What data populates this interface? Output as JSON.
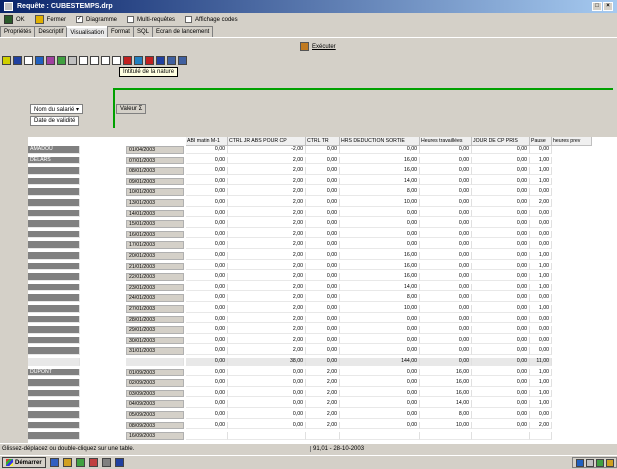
{
  "window": {
    "title": "Requête : CUBESTEMPS.drp"
  },
  "toolbar": {
    "ok_label": "OK",
    "close_label": "Fermer",
    "diagram_label": "Diagramme",
    "multi_label": "Multi-requêtes",
    "codes_label": "Affichage codes",
    "diagram_checked": "✓",
    "multi_checked": "",
    "codes_checked": ""
  },
  "tabs": [
    "Propriétés",
    "Descriptif",
    "Visualisation",
    "Format",
    "SQL",
    "Ecran de lancement"
  ],
  "execute_label": "Exécuter",
  "tooltip": "Intitulé de la nature",
  "fields": {
    "row1": "Nom du salarié",
    "row2": "Date de validité",
    "value": "Valeur"
  },
  "columns": [
    "ABI matin M-1",
    "CTRL JR ABS POUR CP",
    "CTRL TR",
    "HRS DEDUCTION SORTIE",
    "Heures travaillées",
    "JOUR DE CP PRIS",
    "Pause",
    "heures prev"
  ],
  "rows": [
    {
      "name": "AMADOU",
      "date": "01/04/2003",
      "v": [
        "0,00",
        "-2,00",
        "0,00",
        "0,00",
        "0,00",
        "0,00",
        "0,00"
      ],
      "total": false
    },
    {
      "name": "DELARS",
      "date": "07/01/2003",
      "v": [
        "0,00",
        "2,00",
        "0,00",
        "16,00",
        "0,00",
        "0,00",
        "1,00"
      ],
      "total": false
    },
    {
      "name": "",
      "date": "08/01/2003",
      "v": [
        "0,00",
        "2,00",
        "0,00",
        "16,00",
        "0,00",
        "0,00",
        "1,00"
      ],
      "total": false
    },
    {
      "name": "",
      "date": "09/01/2003",
      "v": [
        "0,00",
        "2,00",
        "0,00",
        "14,00",
        "0,00",
        "0,00",
        "1,00"
      ],
      "total": false
    },
    {
      "name": "",
      "date": "10/01/2003",
      "v": [
        "0,00",
        "2,00",
        "0,00",
        "8,00",
        "0,00",
        "0,00",
        "0,00"
      ],
      "total": false
    },
    {
      "name": "",
      "date": "13/01/2003",
      "v": [
        "0,00",
        "2,00",
        "0,00",
        "10,00",
        "0,00",
        "0,00",
        "2,00"
      ],
      "total": false
    },
    {
      "name": "",
      "date": "14/01/2003",
      "v": [
        "0,00",
        "2,00",
        "0,00",
        "0,00",
        "0,00",
        "0,00",
        "0,00"
      ],
      "total": false
    },
    {
      "name": "",
      "date": "15/01/2003",
      "v": [
        "0,00",
        "2,00",
        "0,00",
        "0,00",
        "0,00",
        "0,00",
        "0,00"
      ],
      "total": false
    },
    {
      "name": "",
      "date": "16/01/2003",
      "v": [
        "0,00",
        "2,00",
        "0,00",
        "0,00",
        "0,00",
        "0,00",
        "0,00"
      ],
      "total": false
    },
    {
      "name": "",
      "date": "17/01/2003",
      "v": [
        "0,00",
        "2,00",
        "0,00",
        "0,00",
        "0,00",
        "0,00",
        "0,00"
      ],
      "total": false
    },
    {
      "name": "",
      "date": "20/01/2003",
      "v": [
        "0,00",
        "2,00",
        "0,00",
        "16,00",
        "0,00",
        "0,00",
        "1,00"
      ],
      "total": false
    },
    {
      "name": "",
      "date": "21/01/2003",
      "v": [
        "0,00",
        "2,00",
        "0,00",
        "16,00",
        "0,00",
        "0,00",
        "1,00"
      ],
      "total": false
    },
    {
      "name": "",
      "date": "22/01/2003",
      "v": [
        "0,00",
        "2,00",
        "0,00",
        "16,00",
        "0,00",
        "0,00",
        "1,00"
      ],
      "total": false
    },
    {
      "name": "",
      "date": "23/01/2003",
      "v": [
        "0,00",
        "2,00",
        "0,00",
        "14,00",
        "0,00",
        "0,00",
        "1,00"
      ],
      "total": false
    },
    {
      "name": "",
      "date": "24/01/2003",
      "v": [
        "0,00",
        "2,00",
        "0,00",
        "8,00",
        "0,00",
        "0,00",
        "0,00"
      ],
      "total": false
    },
    {
      "name": "",
      "date": "27/01/2003",
      "v": [
        "0,00",
        "2,00",
        "0,00",
        "10,00",
        "0,00",
        "0,00",
        "1,00"
      ],
      "total": false
    },
    {
      "name": "",
      "date": "28/01/2003",
      "v": [
        "0,00",
        "2,00",
        "0,00",
        "0,00",
        "0,00",
        "0,00",
        "0,00"
      ],
      "total": false
    },
    {
      "name": "",
      "date": "29/01/2003",
      "v": [
        "0,00",
        "2,00",
        "0,00",
        "0,00",
        "0,00",
        "0,00",
        "0,00"
      ],
      "total": false
    },
    {
      "name": "",
      "date": "30/01/2003",
      "v": [
        "0,00",
        "2,00",
        "0,00",
        "0,00",
        "0,00",
        "0,00",
        "0,00"
      ],
      "total": false
    },
    {
      "name": "",
      "date": "31/01/2003",
      "v": [
        "0,00",
        "2,00",
        "0,00",
        "0,00",
        "0,00",
        "0,00",
        "0,00"
      ],
      "total": false
    },
    {
      "name": "",
      "date": "",
      "v": [
        "0,00",
        "38,00",
        "0,00",
        "144,00",
        "0,00",
        "0,00",
        "11,00"
      ],
      "total": true
    },
    {
      "name": "DUPONT",
      "date": "01/09/2003",
      "v": [
        "0,00",
        "0,00",
        "2,00",
        "0,00",
        "16,00",
        "0,00",
        "1,00"
      ],
      "total": false
    },
    {
      "name": "",
      "date": "02/09/2003",
      "v": [
        "0,00",
        "0,00",
        "2,00",
        "0,00",
        "16,00",
        "0,00",
        "1,00"
      ],
      "total": false
    },
    {
      "name": "",
      "date": "03/09/2003",
      "v": [
        "0,00",
        "0,00",
        "2,00",
        "0,00",
        "16,00",
        "0,00",
        "1,00"
      ],
      "total": false
    },
    {
      "name": "",
      "date": "04/09/2003",
      "v": [
        "0,00",
        "0,00",
        "2,00",
        "0,00",
        "14,00",
        "0,00",
        "1,00"
      ],
      "total": false
    },
    {
      "name": "",
      "date": "05/09/2003",
      "v": [
        "0,00",
        "0,00",
        "2,00",
        "0,00",
        "8,00",
        "0,00",
        "0,00"
      ],
      "total": false
    },
    {
      "name": "",
      "date": "08/09/2003",
      "v": [
        "0,00",
        "0,00",
        "2,00",
        "0,00",
        "10,00",
        "0,00",
        "2,00"
      ],
      "total": false
    },
    {
      "name": "",
      "date": "16/09/2003",
      "v": [
        "",
        "",
        "",
        "",
        "",
        "",
        ""
      ],
      "total": false
    }
  ],
  "status": {
    "hint": "Glissez-déplacez ou double-cliquez sur une table.",
    "info": "91,01 - 28-10-2003"
  },
  "taskbar": {
    "start_label": "Démarrer"
  }
}
